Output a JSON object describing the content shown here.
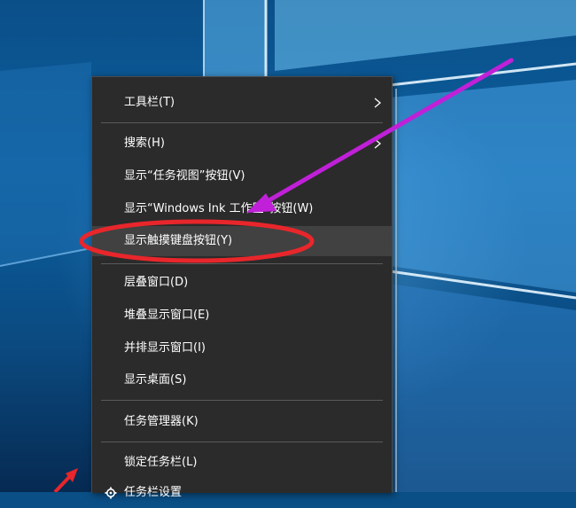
{
  "menu": {
    "items": [
      {
        "label": "工具栏(T)",
        "has_submenu": true
      },
      {
        "label": "搜索(H)",
        "has_submenu": true
      },
      {
        "label": "显示“任务视图”按钮(V)"
      },
      {
        "label": "显示“Windows Ink 工作区”按钮(W)"
      },
      {
        "label": "显示触摸键盘按钮(Y)",
        "highlighted": true
      },
      {
        "label": "层叠窗口(D)"
      },
      {
        "label": "堆叠显示窗口(E)"
      },
      {
        "label": "并排显示窗口(I)"
      },
      {
        "label": "显示桌面(S)"
      },
      {
        "label": "任务管理器(K)"
      },
      {
        "label": "锁定任务栏(L)"
      },
      {
        "label": "任务栏设置",
        "icon": "gear-icon"
      }
    ]
  },
  "annotations": {
    "highlight_ellipse_color": "#e8262b",
    "arrow_color": "#c020d8",
    "corner_arrow_color": "#e8262b"
  },
  "colors": {
    "menu_bg": "#2b2b2b",
    "menu_highlight": "#414141",
    "menu_text": "#ffffff",
    "separator": "#5a5a5a"
  }
}
